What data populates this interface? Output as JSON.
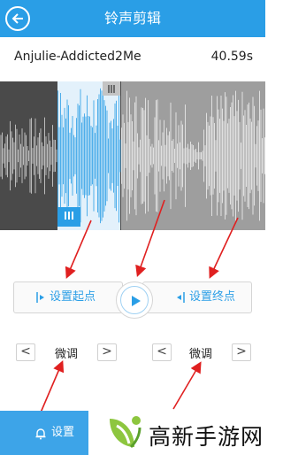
{
  "header": {
    "title": "铃声剪辑",
    "back_icon": "back-arrow-icon"
  },
  "song": {
    "name": "Anjulie-Addicted2Me",
    "duration": "40.59s"
  },
  "controls": {
    "set_start_label": "设置起点",
    "set_end_label": "设置终点",
    "play_icon": "play-icon"
  },
  "fine_tune": {
    "label": "微调",
    "prev_symbol": "<",
    "next_symbol": ">"
  },
  "bottom": {
    "settings_label": "设置",
    "settings_icon": "bell-icon"
  },
  "watermark": {
    "brand": "高新手游网"
  },
  "colors": {
    "accent": "#2a9ee6",
    "selection": "#e3f1fb",
    "wave_dark": "#4a4a4a",
    "wave_light": "#9e9e9e",
    "annotation_arrow": "#e02020"
  }
}
